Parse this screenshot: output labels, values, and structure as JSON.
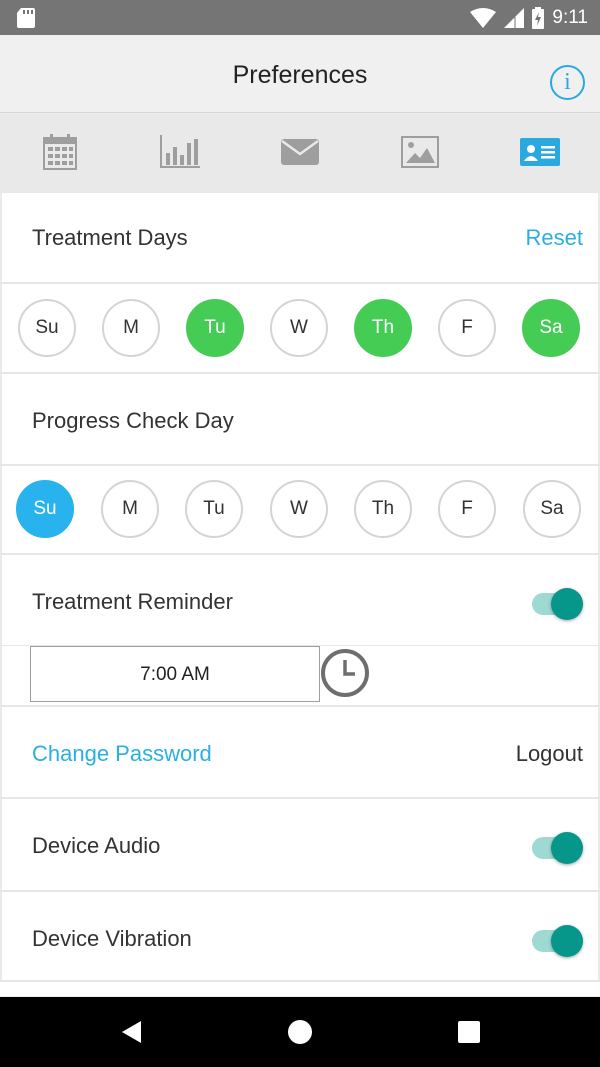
{
  "status_bar": {
    "time": "9:11",
    "icons": [
      "sd-card-icon",
      "wifi-icon",
      "signal-icon",
      "battery-charging-icon"
    ]
  },
  "header": {
    "title": "Preferences",
    "info_label": "i"
  },
  "tabs": [
    {
      "icon": "calendar-icon",
      "active": false
    },
    {
      "icon": "bar-chart-icon",
      "active": false
    },
    {
      "icon": "mail-icon",
      "active": false
    },
    {
      "icon": "image-icon",
      "active": false
    },
    {
      "icon": "profile-card-icon",
      "active": true
    }
  ],
  "treatment_days": {
    "label": "Treatment Days",
    "reset_label": "Reset",
    "days": [
      {
        "label": "Su",
        "selected": false
      },
      {
        "label": "M",
        "selected": false
      },
      {
        "label": "Tu",
        "selected": true
      },
      {
        "label": "W",
        "selected": false
      },
      {
        "label": "Th",
        "selected": true
      },
      {
        "label": "F",
        "selected": false
      },
      {
        "label": "Sa",
        "selected": true
      }
    ]
  },
  "progress_check_day": {
    "label": "Progress Check Day",
    "days": [
      {
        "label": "Su",
        "selected": true
      },
      {
        "label": "M",
        "selected": false
      },
      {
        "label": "Tu",
        "selected": false
      },
      {
        "label": "W",
        "selected": false
      },
      {
        "label": "Th",
        "selected": false
      },
      {
        "label": "F",
        "selected": false
      },
      {
        "label": "Sa",
        "selected": false
      }
    ]
  },
  "treatment_reminder": {
    "label": "Treatment Reminder",
    "enabled": true,
    "time": "7:00 AM"
  },
  "account": {
    "change_password_label": "Change Password",
    "logout_label": "Logout"
  },
  "device_audio": {
    "label": "Device Audio",
    "enabled": true
  },
  "device_vibration": {
    "label": "Device Vibration",
    "enabled": true
  },
  "colors": {
    "accent_blue": "#29b3ee",
    "selected_green": "#45cc55",
    "toggle_teal": "#07968a",
    "link_blue": "#2ab0e0"
  }
}
